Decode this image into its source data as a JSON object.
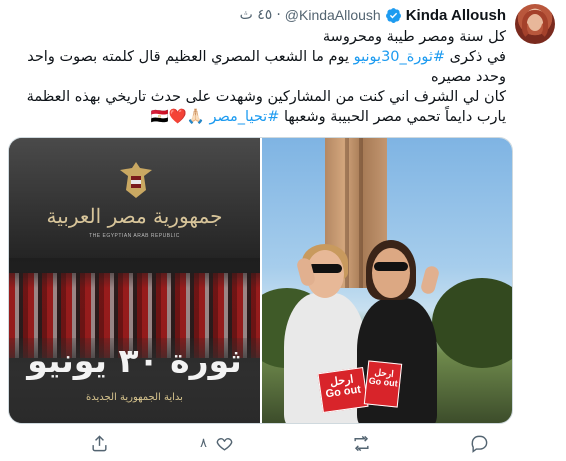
{
  "author": {
    "name": "Kinda Alloush",
    "handle": "@KindaAlloush",
    "time": "٤٥ ث",
    "verified": true
  },
  "tweet": {
    "lines": [
      {
        "text": "كل سنة ومصر طيبة ومحروسة"
      },
      {
        "prefix": "في ذكرى ",
        "hashtag": "#ثورة_30يونيو",
        "suffix": "  يوم ما الشعب المصري العظيم قال كلمته بصوت واحد"
      },
      {
        "text": "وحدد مصيره"
      },
      {
        "text": "كان لي الشرف اني كنت من المشاركين وشهدت على حدث تاريخي بهذه العظمة"
      },
      {
        "prefix": "يارب دايماً تحمي مصر الحبيبة وشعبها ",
        "hashtag": "#تحيا_مصر",
        "suffix": " 🙏🏻❤️🇪🇬"
      }
    ]
  },
  "media": {
    "left_poster": {
      "emblem_title": "جمهورية مصر العربية",
      "emblem_subtitle": "THE EGYPTIAN ARAB REPUBLIC",
      "headline": "ثورة ٣٠ يونيو",
      "tagline": "بداية الجمهورية الجديدة"
    },
    "right_photo": {
      "sign_1": "ارحل\nGo out",
      "sign_2": "ارحل\nGo out"
    }
  },
  "actions": {
    "reply_count": "",
    "retweet_count": "",
    "like_count": "٨",
    "share_count": ""
  },
  "colors": {
    "accent": "#1d9bf0",
    "text": "#0f1419",
    "muted": "#536471"
  }
}
